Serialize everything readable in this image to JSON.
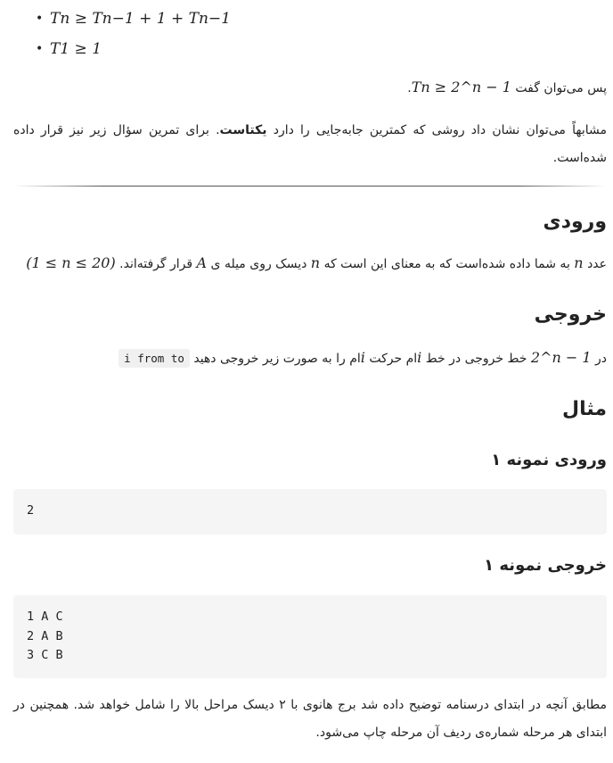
{
  "bullets": {
    "item1": "Tn ≥ Tn−1 + 1 + Tn−1",
    "item2": "T1 ≥ 1"
  },
  "conclusion": {
    "text": "پس می‌توان گفت",
    "formula": "Tn ≥ 2^n − 1",
    "end": "."
  },
  "paragraph1": {
    "before": "مشابهاً می‌توان نشان داد روشی که کمترین جابه‌جایی را دارد ",
    "bold": "یکتاست",
    "after": ". برای تمرین سؤال زیر نیز قرار داده شده‌است."
  },
  "input_section": {
    "heading": "ورودی",
    "t1": "عدد",
    "t2": "به شما داده شده‌است که به معنای این است که",
    "t3": "دیسک روی میله ی",
    "t4": "قرار گرفته‌اند.",
    "var_n": "n",
    "var_A": "A",
    "constraint": "(1 ≤ n ≤ 20)"
  },
  "output_section": {
    "heading": "خروجی",
    "t1": "در",
    "formula": "2^n − 1",
    "t2": "خط خروجی در خط",
    "var_i": "i",
    "t3": "ام حرکت",
    "t4": "ام را به صورت زیر خروجی دهید",
    "code": "i from to"
  },
  "example_heading": "مثال",
  "sample_input": {
    "heading": "ورودی نمونه ۱",
    "lines": [
      "2"
    ]
  },
  "sample_output": {
    "heading": "خروجی نمونه ۱",
    "lines": [
      "1 A C",
      "2 A B",
      "3 C B"
    ]
  },
  "explanation": "مطابق آنچه در ابتدای درسنامه توضیح داده شد برج هانوی با ۲ دیسک مراحل بالا را شامل خواهد شد. همچنین در ابتدای هر مرحله شماره‌ی ردیف آن مرحله چاپ می‌شود."
}
